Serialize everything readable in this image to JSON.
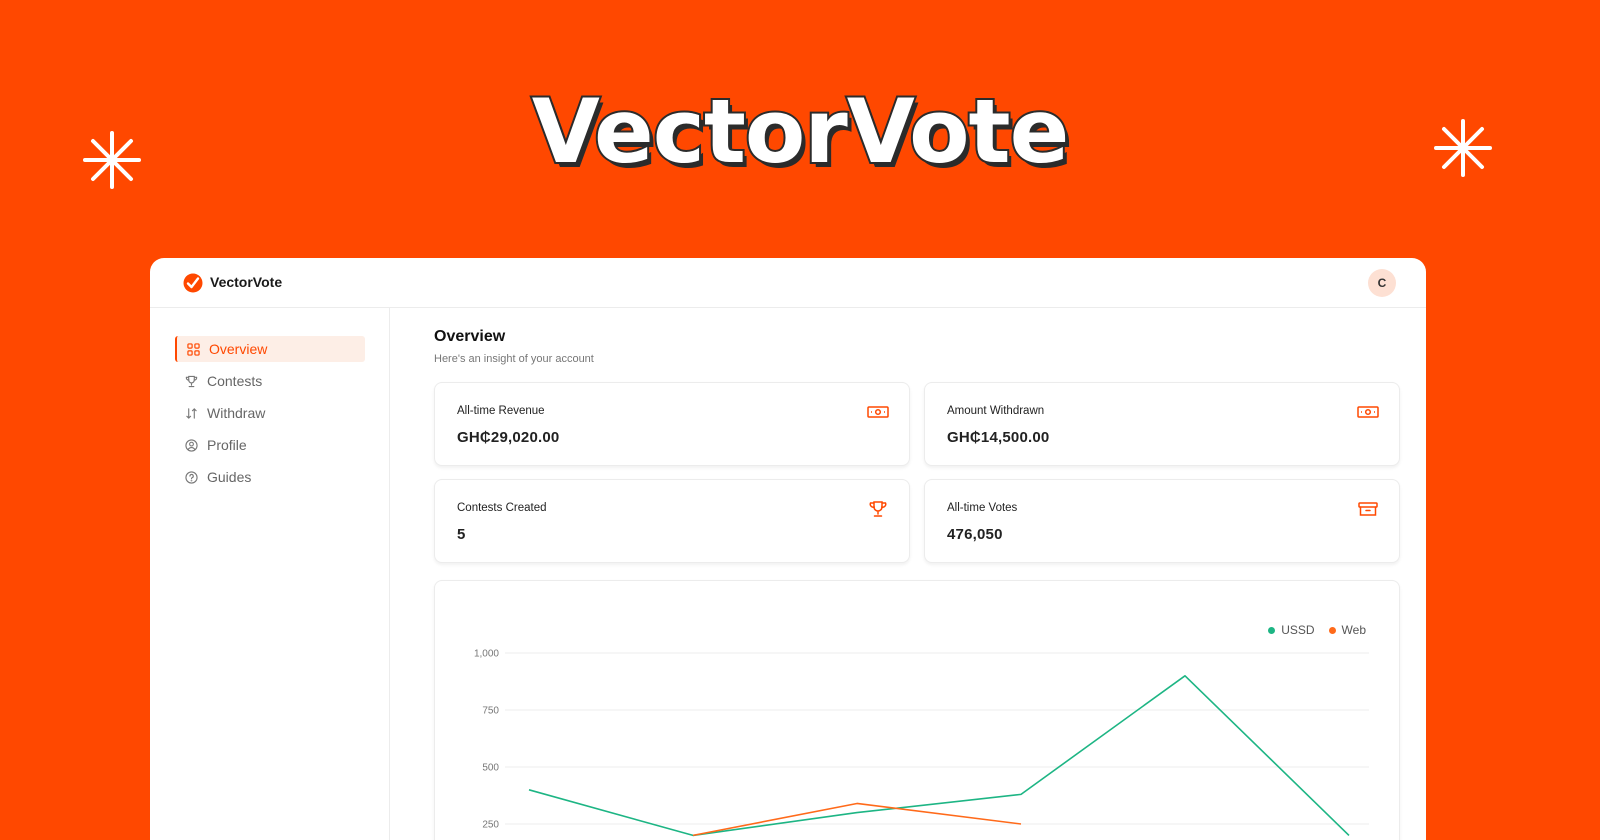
{
  "hero": {
    "title": "VectorVote"
  },
  "app": {
    "brand": "VectorVote",
    "avatar_initial": "C"
  },
  "sidebar": {
    "items": [
      {
        "label": "Overview",
        "icon": "grid-icon",
        "active": true
      },
      {
        "label": "Contests",
        "icon": "trophy-icon",
        "active": false
      },
      {
        "label": "Withdraw",
        "icon": "arrows-updown-icon",
        "active": false
      },
      {
        "label": "Profile",
        "icon": "user-circle-icon",
        "active": false
      },
      {
        "label": "Guides",
        "icon": "help-circle-icon",
        "active": false
      }
    ]
  },
  "main": {
    "title": "Overview",
    "subtitle": "Here's an insight of your account",
    "stats": [
      {
        "label": "All-time Revenue",
        "value": "GH₵29,020.00",
        "icon": "cash-icon"
      },
      {
        "label": "Amount Withdrawn",
        "value": "GH₵14,500.00",
        "icon": "cash-icon"
      },
      {
        "label": "Contests Created",
        "value": "5",
        "icon": "trophy-icon"
      },
      {
        "label": "All-time Votes",
        "value": "476,050",
        "icon": "archive-icon"
      }
    ]
  },
  "colors": {
    "brand": "#FF4800",
    "ussd": "#1DB584",
    "web": "#FF6A1A"
  },
  "chart_data": {
    "type": "line",
    "x": [
      0,
      1,
      2,
      3,
      4,
      5,
      6
    ],
    "y_ticks": [
      1000,
      750,
      500,
      250
    ],
    "y_tick_labels": [
      "1,000",
      "750",
      "500",
      "250"
    ],
    "ylim": [
      0,
      1000
    ],
    "grid": true,
    "legend_position": "top-right",
    "series": [
      {
        "name": "USSD",
        "values": [
          400,
          200,
          300,
          380,
          900,
          200
        ]
      },
      {
        "name": "Web",
        "values": [
          null,
          200,
          340,
          250,
          null,
          null
        ]
      }
    ]
  }
}
